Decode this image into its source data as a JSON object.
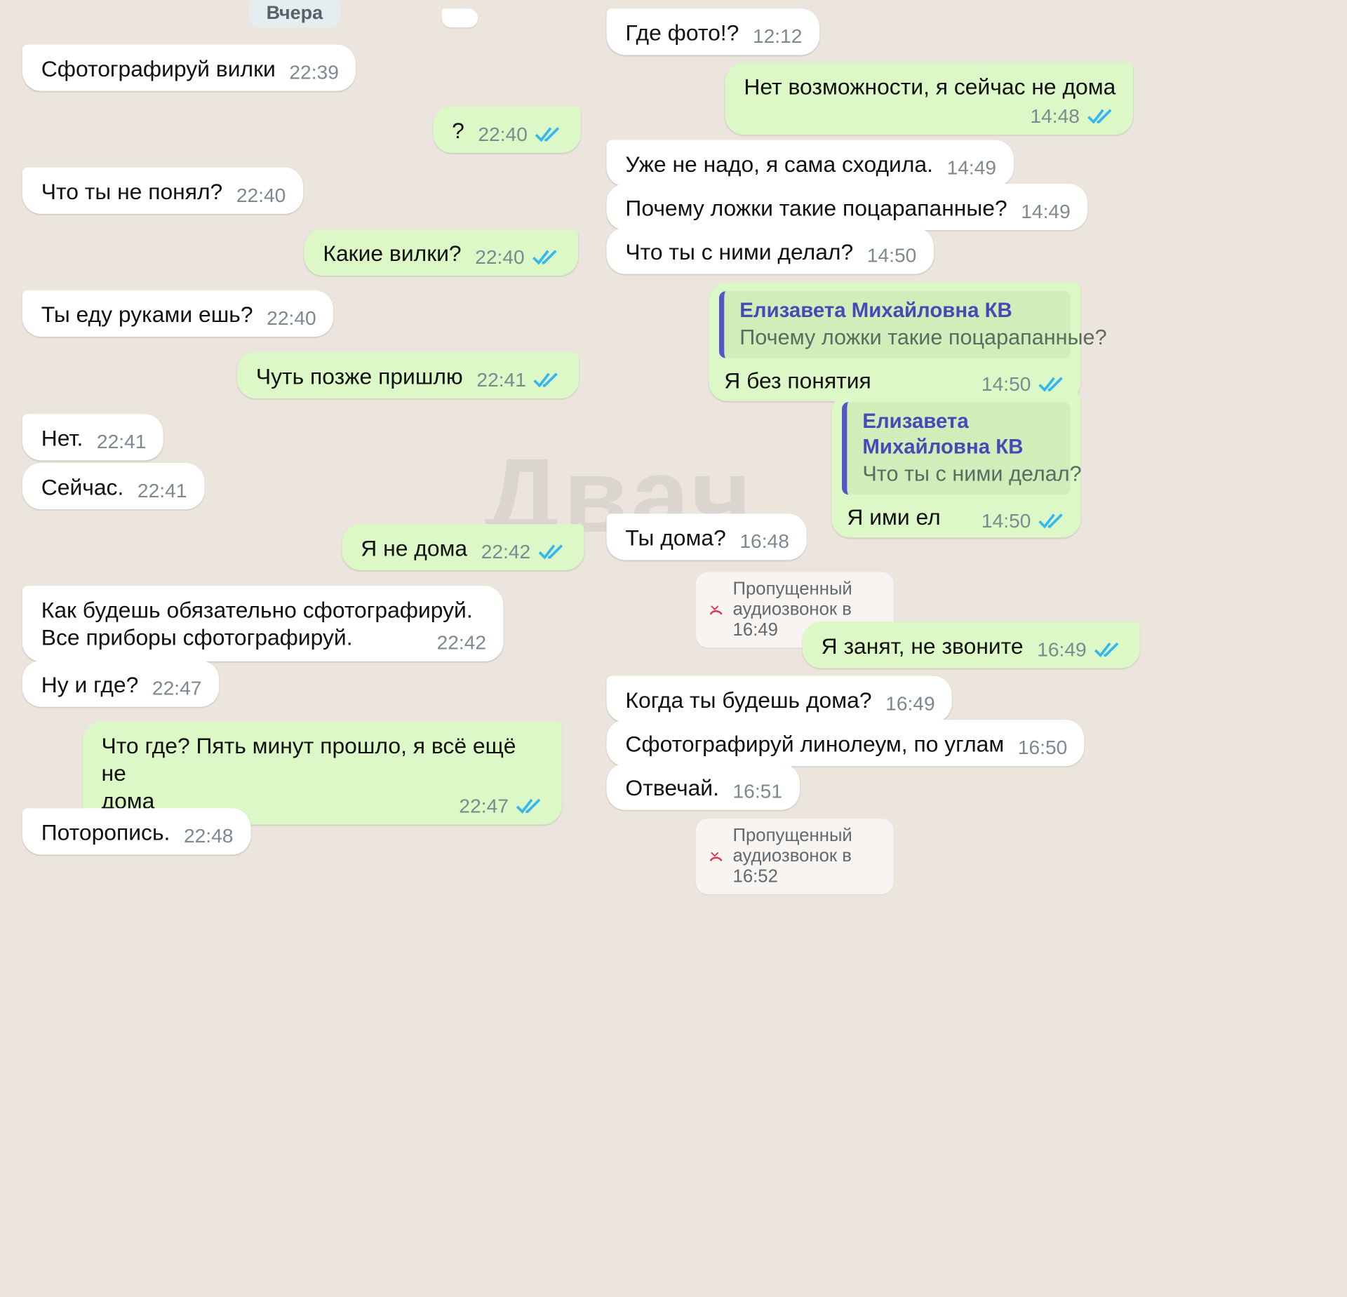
{
  "date_label": "Вчера",
  "colors": {
    "incoming": "#ffffff",
    "outgoing": "#dcf8c6",
    "tick": "#34b7f1",
    "quote_bar": "#5755c6",
    "missed_call": "#e23350"
  },
  "watermark": "Двач",
  "left": {
    "messages": [
      {
        "dir": "in",
        "text": "Сфотографируй вилки",
        "time": "22:39"
      },
      {
        "dir": "out",
        "text": "?",
        "time": "22:40",
        "read": true
      },
      {
        "dir": "in",
        "text": "Что ты не понял?",
        "time": "22:40"
      },
      {
        "dir": "out",
        "text": "Какие вилки?",
        "time": "22:40",
        "read": true
      },
      {
        "dir": "in",
        "text": "Ты еду руками ешь?",
        "time": "22:40"
      },
      {
        "dir": "out",
        "text": "Чуть позже пришлю",
        "time": "22:41",
        "read": true
      },
      {
        "dir": "in",
        "text": "Нет.",
        "time": "22:41"
      },
      {
        "dir": "in",
        "text": "Сейчас.",
        "time": "22:41"
      },
      {
        "dir": "out",
        "text": "Я не дома",
        "time": "22:42",
        "read": true
      },
      {
        "dir": "in",
        "text": "Как будешь обязательно сфотографируй.\nВсе приборы сфотографируй.",
        "time": "22:42"
      },
      {
        "dir": "in",
        "text": "Ну и где?",
        "time": "22:47"
      },
      {
        "dir": "out",
        "text": "Что где? Пять минут прошло, я всё ещё не\nдома",
        "time": "22:47",
        "read": true
      },
      {
        "dir": "in",
        "text": "Поторопись.",
        "time": "22:48"
      }
    ]
  },
  "right": {
    "messages": [
      {
        "dir": "in",
        "text": "Где фото!?",
        "time": "12:12"
      },
      {
        "dir": "out",
        "text": "Нет возможности, я сейчас не дома",
        "time": "14:48",
        "read": true
      },
      {
        "dir": "in",
        "text": "Уже не надо, я сама сходила.",
        "time": "14:49"
      },
      {
        "dir": "in",
        "text": "Почему ложки такие поцарапанные?",
        "time": "14:49"
      },
      {
        "dir": "in",
        "text": "Что ты с ними делал?",
        "time": "14:50"
      },
      {
        "dir": "out",
        "quote": {
          "author": "Елизавета Михайловна КВ",
          "text": "Почему ложки такие поцарапанные?"
        },
        "text": "Я без понятия",
        "time": "14:50",
        "read": true
      },
      {
        "dir": "out",
        "quote": {
          "author": "Елизавета Михайловна КВ",
          "text": "Что ты с ними делал?"
        },
        "text": "Я ими ел",
        "time": "14:50",
        "read": true
      },
      {
        "dir": "in",
        "text": "Ты дома?",
        "time": "16:48"
      },
      {
        "dir": "system",
        "text": "Пропущенный аудиозвонок в 16:49",
        "icon": "missed-call-icon"
      },
      {
        "dir": "out",
        "text": "Я занят, не звоните",
        "time": "16:49",
        "read": true
      },
      {
        "dir": "in",
        "text": "Когда ты будешь дома?",
        "time": "16:49"
      },
      {
        "dir": "in",
        "text": "Сфотографируй линолеум, по углам",
        "time": "16:50"
      },
      {
        "dir": "in",
        "text": "Отвечай.",
        "time": "16:51"
      },
      {
        "dir": "system",
        "text": "Пропущенный аудиозвонок в 16:52",
        "icon": "missed-call-icon"
      }
    ]
  }
}
